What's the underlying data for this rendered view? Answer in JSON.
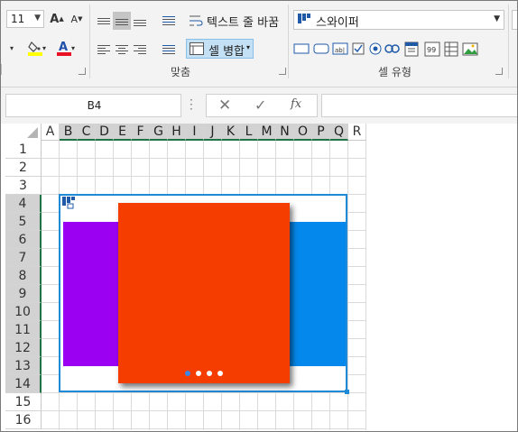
{
  "ribbon": {
    "font_size": "11",
    "wrap_text_label": "텍스트 줄 바꿈",
    "merge_label": "셀 병합",
    "alignment_group_label": "맞춤",
    "style_combo_value": "스와이퍼",
    "cell_style_group_label": "셀 유형"
  },
  "formula_bar": {
    "name_box": "B4",
    "fx_label": "fx",
    "formula": ""
  },
  "sheet": {
    "columns": [
      "A",
      "B",
      "C",
      "D",
      "E",
      "F",
      "G",
      "H",
      "I",
      "J",
      "K",
      "L",
      "M",
      "N",
      "O",
      "P",
      "Q",
      "R"
    ],
    "selected_columns": [
      "B",
      "C",
      "D",
      "E",
      "F",
      "G",
      "H",
      "I",
      "J",
      "K",
      "L",
      "M",
      "N",
      "O",
      "P",
      "Q"
    ],
    "rows": [
      "1",
      "2",
      "3",
      "4",
      "5",
      "6",
      "7",
      "8",
      "9",
      "10",
      "11",
      "12",
      "13",
      "14",
      "15",
      "16"
    ],
    "selected_rows": [
      "4",
      "5",
      "6",
      "7",
      "8",
      "9",
      "10",
      "11",
      "12",
      "13",
      "14"
    ]
  },
  "swiper": {
    "slides": [
      {
        "name": "purple-slide",
        "color": "#9B00F2"
      },
      {
        "name": "orange-slide",
        "color": "#F53D00"
      },
      {
        "name": "blue-slide",
        "color": "#0488EC"
      }
    ],
    "active_index": 0,
    "dot_count": 4,
    "dot_active_color": "#3c86e8",
    "dot_inactive_color": "#ffffff"
  },
  "colors": {
    "accent": "#217346",
    "selection": "#1f8ad8",
    "font_color_underline": "#e81123",
    "fill_color_underline": "#ffff00"
  }
}
